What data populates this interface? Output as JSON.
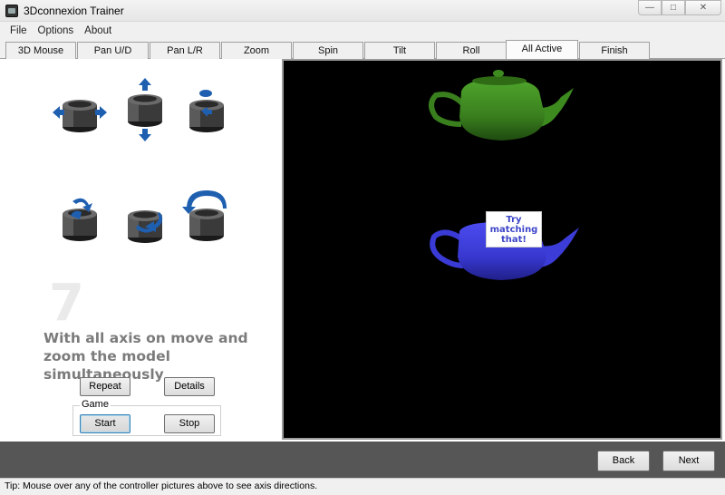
{
  "window": {
    "title": "3Dconnexion Trainer"
  },
  "menu": {
    "items": [
      "File",
      "Options",
      "About"
    ]
  },
  "tabs": [
    {
      "label": "3D Mouse",
      "active": false
    },
    {
      "label": "Pan U/D",
      "active": false
    },
    {
      "label": "Pan L/R",
      "active": false
    },
    {
      "label": "Zoom",
      "active": false
    },
    {
      "label": "Spin",
      "active": false
    },
    {
      "label": "Tilt",
      "active": false
    },
    {
      "label": "Roll",
      "active": false
    },
    {
      "label": "All Active",
      "active": true
    },
    {
      "label": "Finish",
      "active": false
    }
  ],
  "lesson": {
    "step_number": "7",
    "instruction": "With all axis on move and zoom the model simultaneously",
    "controller_pictures": [
      "pan-left-right",
      "pan-up-down",
      "zoom",
      "tilt",
      "spin",
      "roll"
    ]
  },
  "buttons": {
    "repeat": "Repeat",
    "details": "Details",
    "start": "Start",
    "stop": "Stop",
    "back": "Back",
    "next": "Next"
  },
  "game": {
    "legend": "Game"
  },
  "viewport": {
    "target_teapot_color": "#3f8a1f",
    "model_teapot_color": "#3a3ad6",
    "overlay_label": "Try\nmatching\nthat!"
  },
  "status": {
    "tip": "Tip: Mouse over any of the controller pictures above to see axis directions."
  },
  "colors": {
    "accent_arrow": "#1f5fb0",
    "viewport_bg": "#000000",
    "bottom_bar": "#565656"
  }
}
